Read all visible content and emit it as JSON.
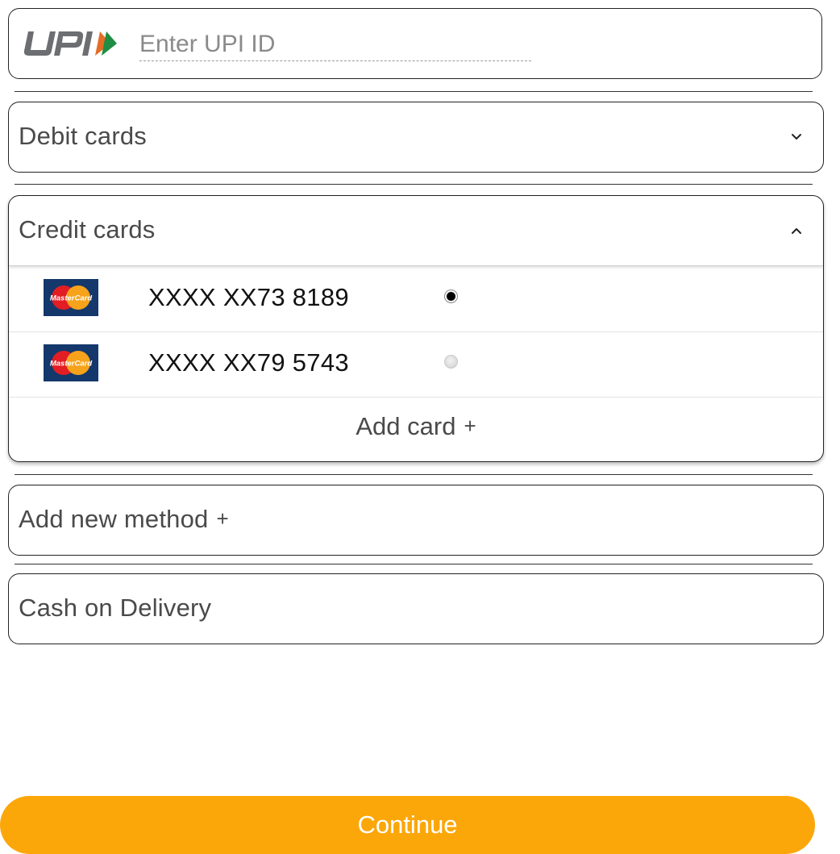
{
  "upi": {
    "logo_text": "UPI",
    "placeholder": "Enter UPI ID",
    "value": ""
  },
  "debit_cards": {
    "title": "Debit cards",
    "icon": "chevron-down-icon"
  },
  "credit_cards": {
    "title": "Credit cards",
    "icon": "chevron-up-icon",
    "cards": [
      {
        "brand_text": "MasterCard",
        "number": "XXXX XX73 8189",
        "selected": true
      },
      {
        "brand_text": "MasterCard",
        "number": "XXXX XX79 5743",
        "selected": false
      }
    ],
    "add_card_label": "Add card",
    "add_card_icon": "+"
  },
  "add_new_method": {
    "label": "Add new method",
    "icon": "+"
  },
  "cash_on_delivery": {
    "label": "Cash on Delivery"
  },
  "continue_button": {
    "label": "Continue"
  },
  "colors": {
    "accent": "#fba70a",
    "border": "#222222",
    "text": "#4a4a4a"
  }
}
